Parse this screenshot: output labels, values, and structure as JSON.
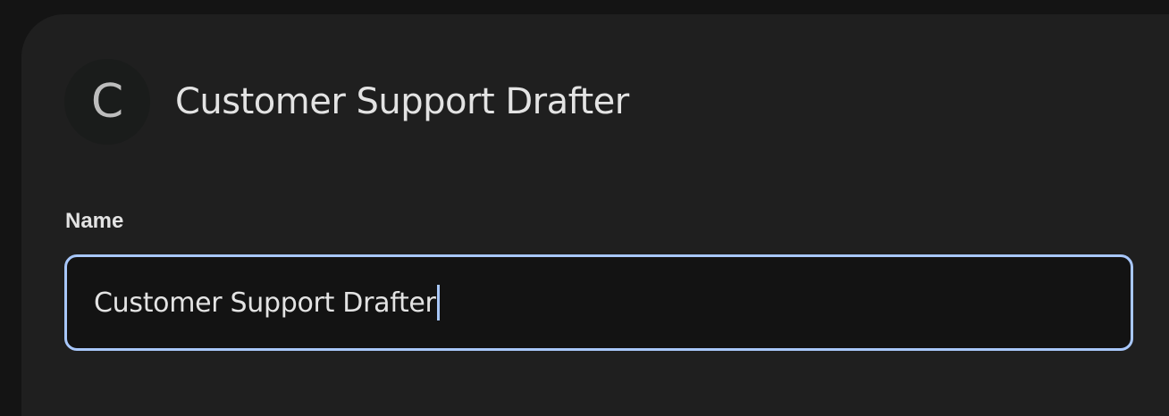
{
  "header": {
    "avatar_letter": "C",
    "title": "Customer Support Drafter"
  },
  "form": {
    "name_label": "Name",
    "name_value": "Customer Support Drafter"
  },
  "colors": {
    "focus_accent": "#a8c7fa",
    "panel_background": "#1f1f1f",
    "input_background": "#131313"
  }
}
